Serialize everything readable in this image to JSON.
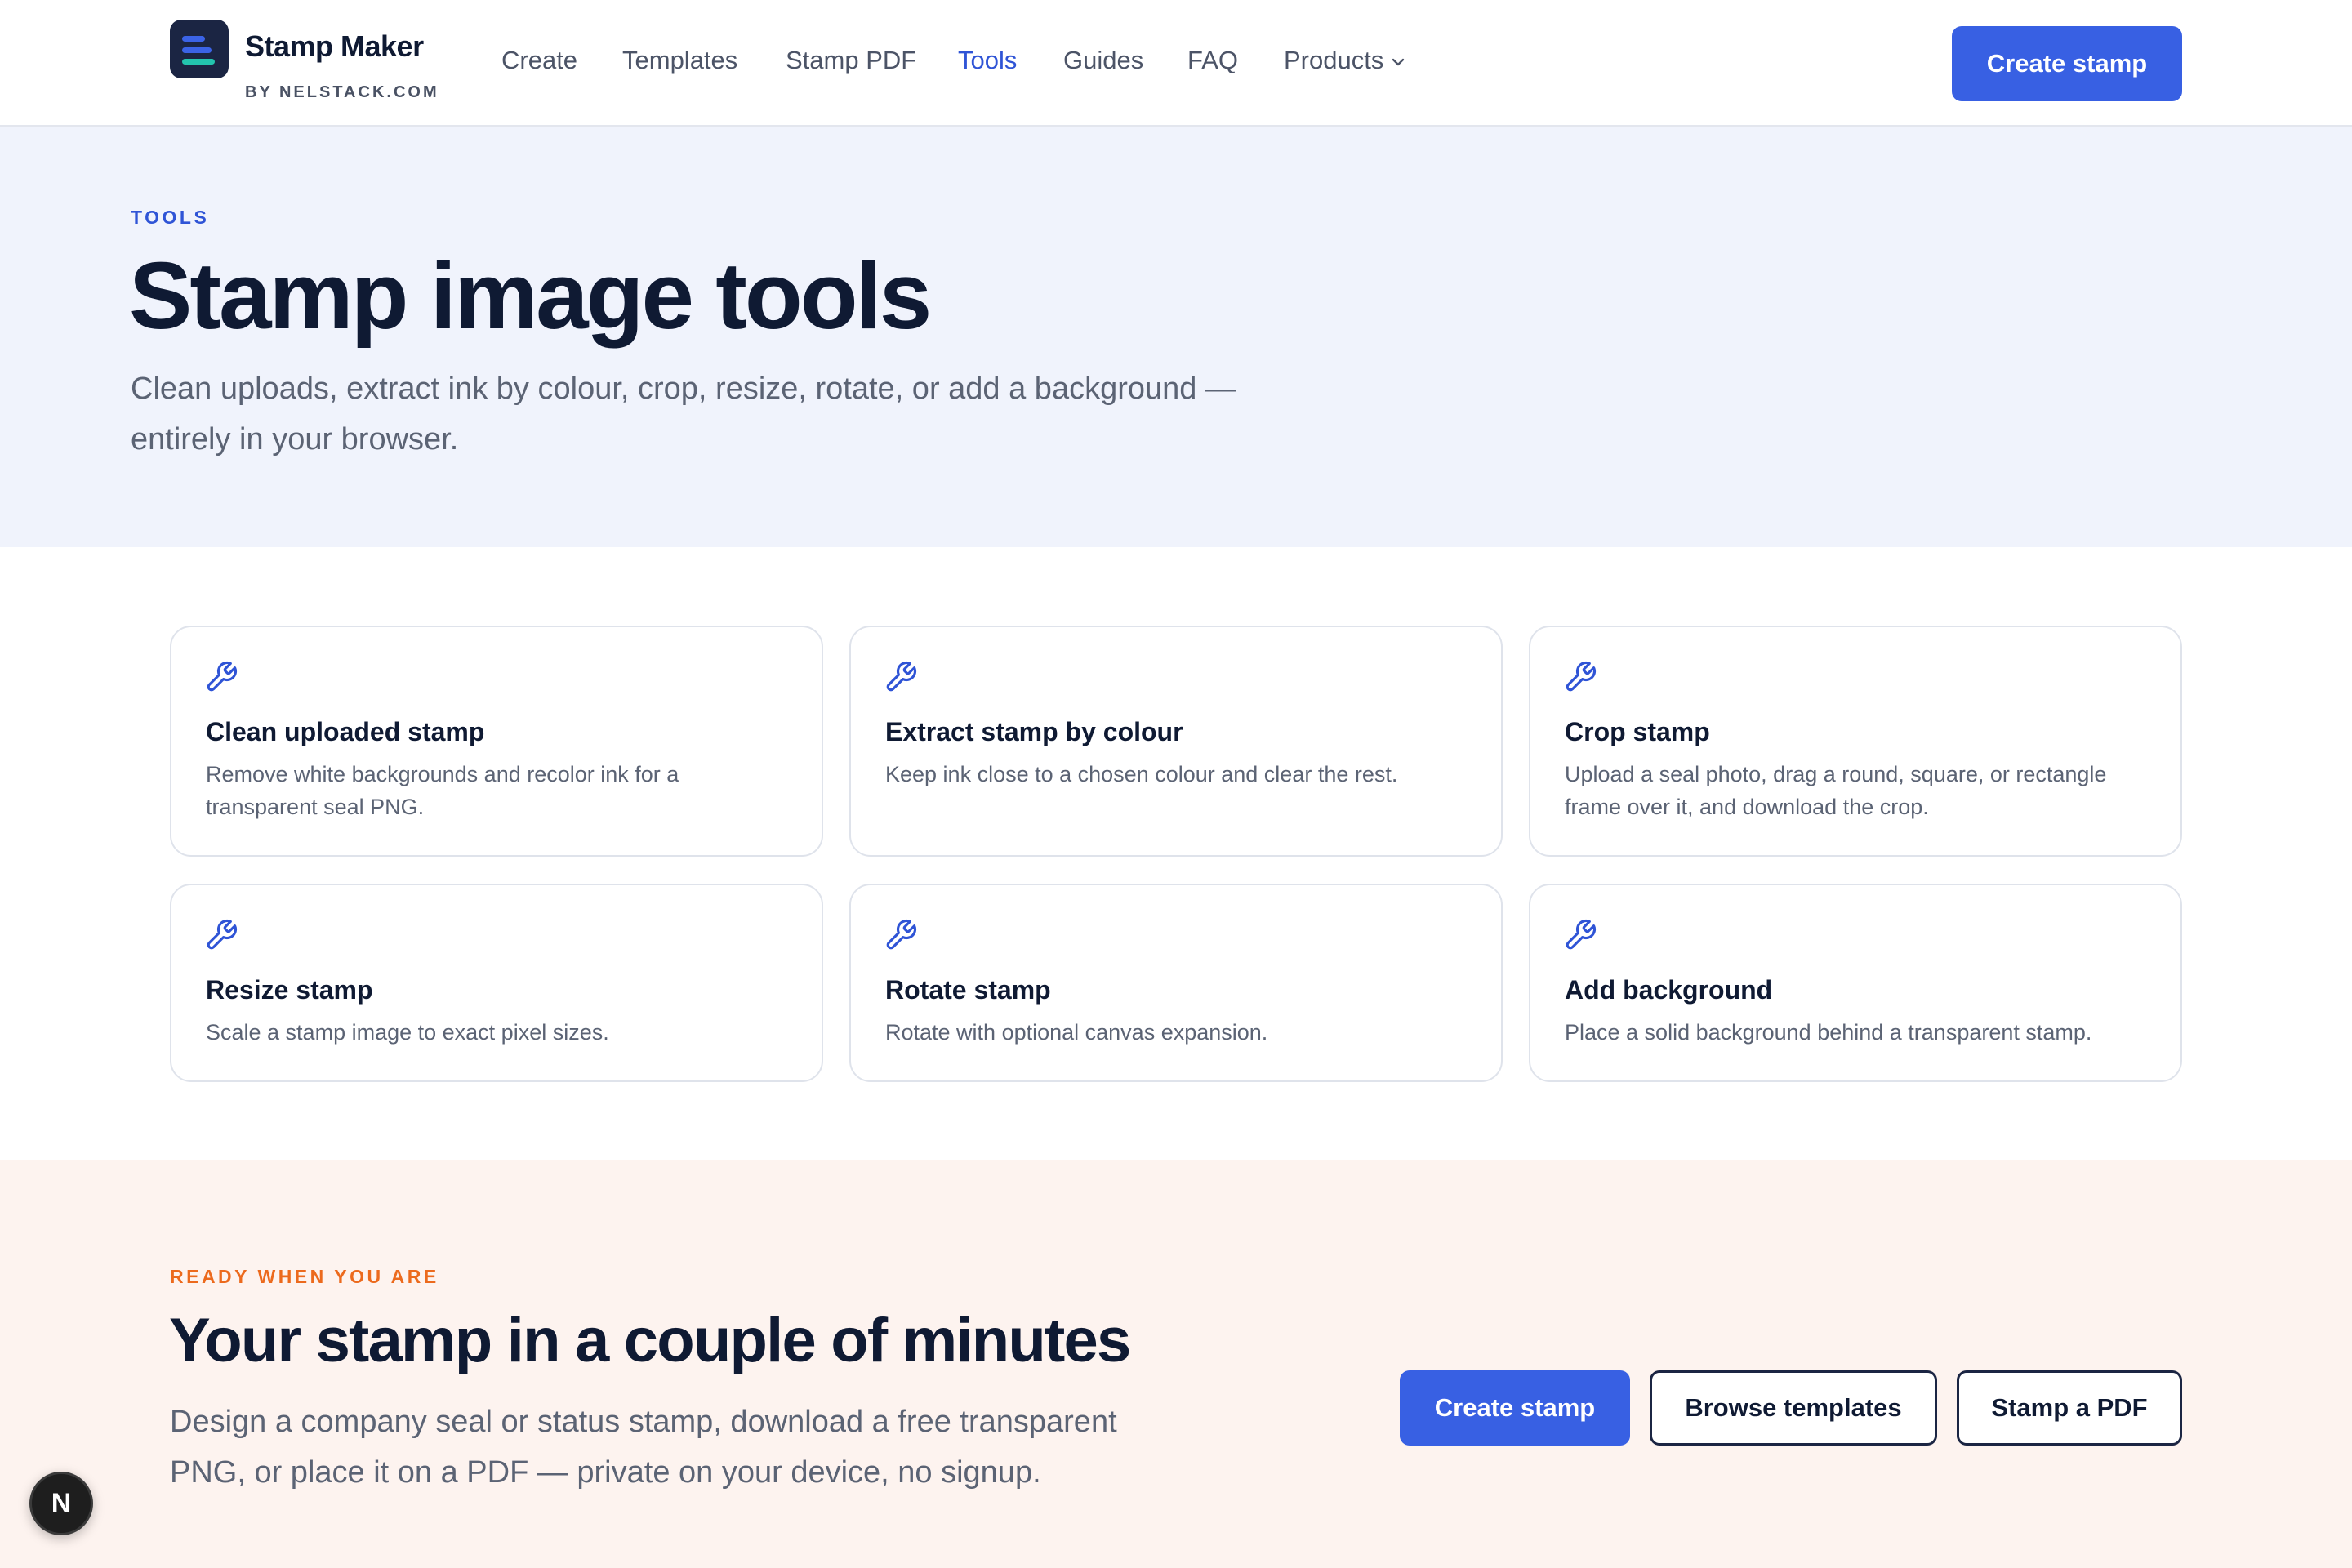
{
  "header": {
    "brand_name": "Stamp Maker",
    "brand_sub": "BY NELSTACK.COM",
    "nav": [
      {
        "label": "Create"
      },
      {
        "label": "Templates"
      },
      {
        "label": "Stamp PDF"
      },
      {
        "label": "Tools",
        "active": true
      },
      {
        "label": "Guides"
      },
      {
        "label": "FAQ"
      },
      {
        "label": "Products",
        "has_dropdown": true
      }
    ],
    "cta_label": "Create stamp"
  },
  "hero": {
    "eyebrow": "TOOLS",
    "title": "Stamp image tools",
    "subtitle": "Clean uploads, extract ink by colour, crop, resize, rotate, or add a background — entirely in your browser."
  },
  "tools": [
    {
      "icon": "wrench-icon",
      "title": "Clean uploaded stamp",
      "desc": "Remove white backgrounds and recolor ink for a transparent seal PNG."
    },
    {
      "icon": "wrench-icon",
      "title": "Extract stamp by colour",
      "desc": "Keep ink close to a chosen colour and clear the rest."
    },
    {
      "icon": "wrench-icon",
      "title": "Crop stamp",
      "desc": "Upload a seal photo, drag a round, square, or rectangle frame over it, and download the crop."
    },
    {
      "icon": "wrench-icon",
      "title": "Resize stamp",
      "desc": "Scale a stamp image to exact pixel sizes."
    },
    {
      "icon": "wrench-icon",
      "title": "Rotate stamp",
      "desc": "Rotate with optional canvas expansion."
    },
    {
      "icon": "wrench-icon",
      "title": "Add background",
      "desc": "Place a solid background behind a transparent stamp."
    }
  ],
  "cta": {
    "eyebrow": "READY WHEN YOU ARE",
    "title": "Your stamp in a couple of minutes",
    "subtitle": "Design a company seal or status stamp, download a free transparent PNG, or place it on a PDF — private on your device, no signup.",
    "buttons": [
      "Create stamp",
      "Browse templates",
      "Stamp a PDF"
    ]
  },
  "floating_badge": "N",
  "colors": {
    "accent": "#3860e3",
    "nav_active": "#2f54d6",
    "hero_bg": "#f0f3fc",
    "cta_bg": "#fdf3ef",
    "cta_eyebrow": "#ec6a1d",
    "text_dark": "#0f1a33"
  }
}
